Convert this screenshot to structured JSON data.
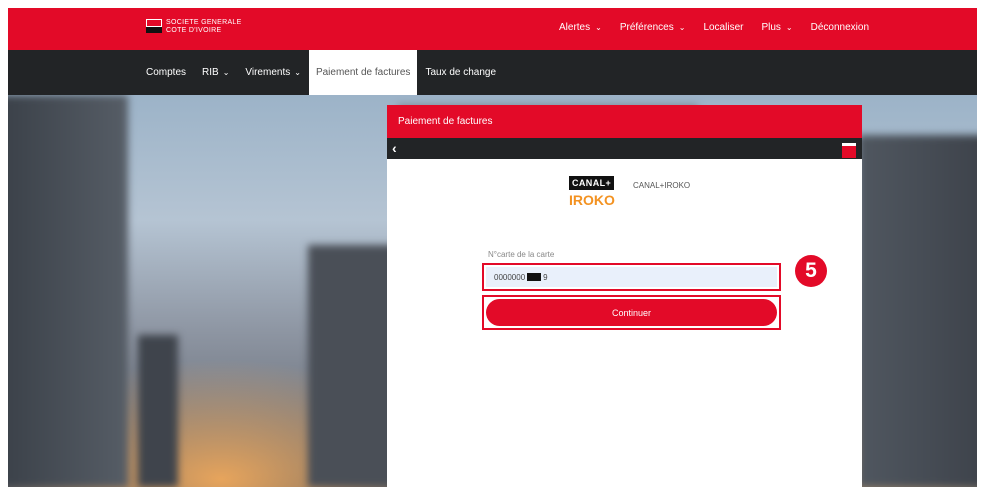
{
  "header": {
    "logo_line1": "SOCIETE GENERALE",
    "logo_line2": "COTE D'IVOIRE",
    "nav": [
      {
        "label": "Alertes",
        "has_menu": true
      },
      {
        "label": "Préférences",
        "has_menu": true
      },
      {
        "label": "Localiser",
        "has_menu": false
      },
      {
        "label": "Plus",
        "has_menu": true
      },
      {
        "label": "Déconnexion",
        "has_menu": false
      }
    ]
  },
  "mainnav": {
    "items": [
      {
        "label": "Comptes"
      },
      {
        "label": "RIB"
      },
      {
        "label": "Virements"
      },
      {
        "label": "Paiement de factures"
      },
      {
        "label": "Taux de change"
      }
    ]
  },
  "modal": {
    "title": "Paiement de factures",
    "biller_logo_top": "CANAL+",
    "biller_logo_bottom": "IROKO",
    "biller_name": "CANAL+IROKO",
    "field_label": "N°carte de la carte",
    "field_value_prefix": "0000000",
    "field_value_suffix": "9",
    "submit_label": "Continuer"
  },
  "annotation": {
    "step_number": "5"
  },
  "colors": {
    "brand_red": "#e30a28",
    "nav_dark": "#222426"
  }
}
